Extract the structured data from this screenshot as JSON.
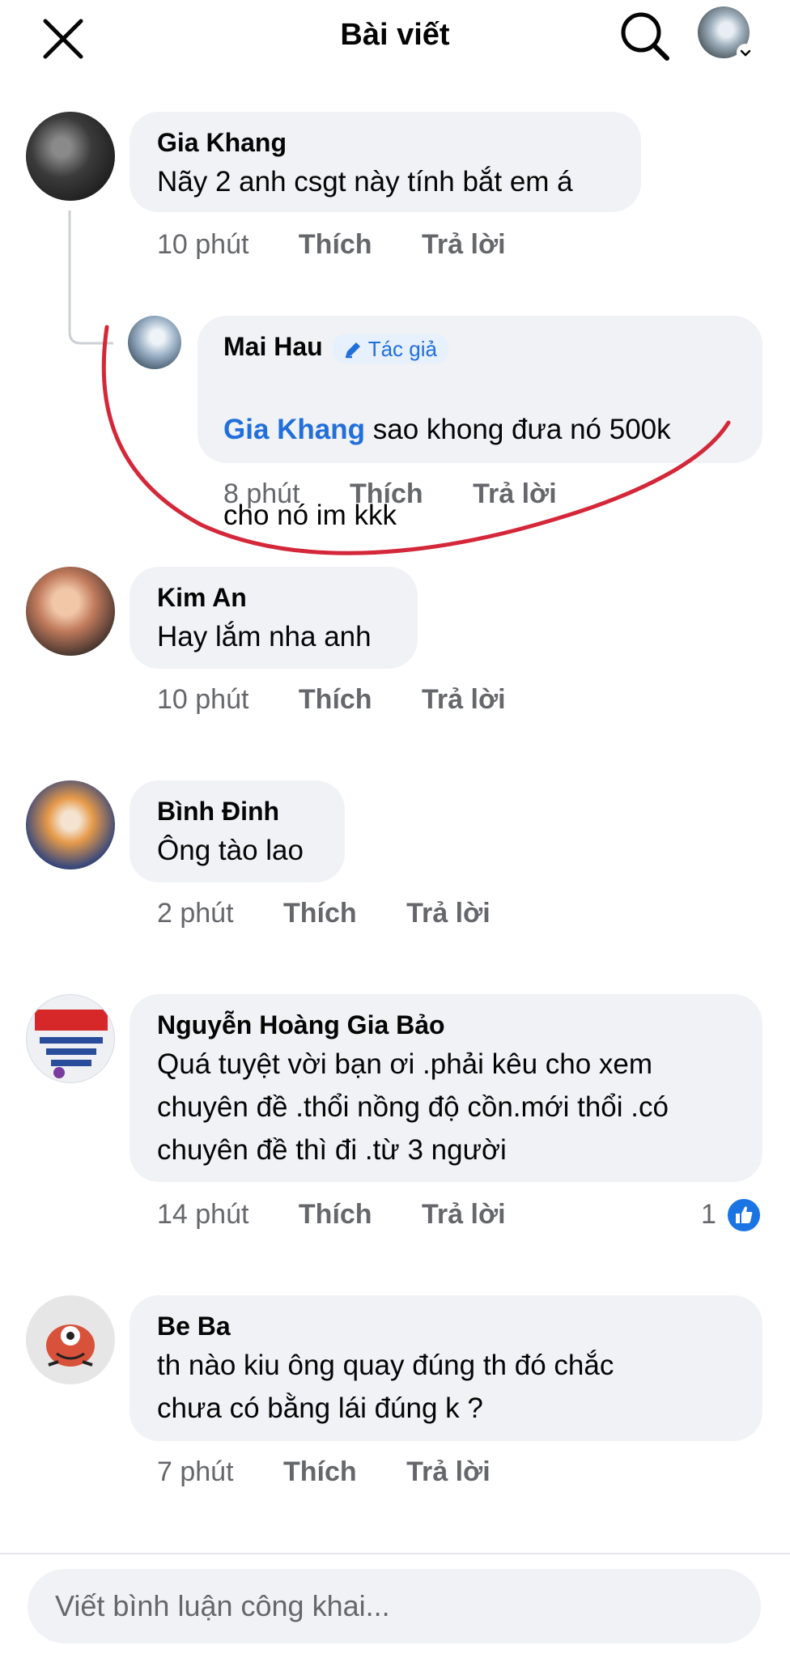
{
  "header": {
    "title": "Bài viết",
    "close_icon": "close-icon",
    "search_icon": "search-icon"
  },
  "comments": [
    {
      "author": "Gia Khang",
      "text": "Nãy 2 anh csgt này tính bắt em á",
      "time": "10 phút",
      "like": "Thích",
      "reply": "Trả lời"
    },
    {
      "author": "Mai Hau",
      "badge": "Tác giả",
      "mention": "Gia Khang",
      "text_line1": "sao khong đưa nó 500k",
      "text_line2": "cho nó im kkk",
      "time": "8 phút",
      "like": "Thích",
      "reply": "Trả lời"
    },
    {
      "author": "Kim An",
      "text": "Hay lắm nha anh",
      "time": "10 phút",
      "like": "Thích",
      "reply": "Trả lời"
    },
    {
      "author": "Bình Đinh",
      "text": "Ông tào lao",
      "time": "2 phút",
      "like": "Thích",
      "reply": "Trả lời"
    },
    {
      "author": "Nguyễn Hoàng Gia Bảo",
      "text": "Quá tuyệt vời bạn ơi .phải kêu cho xem\nchuyên đề .thổi nồng độ cồn.mới thổi .có\nchuyên đề thì đi .từ 3 người",
      "time": "14 phút",
      "like": "Thích",
      "reply": "Trả lời",
      "reaction_count": "1"
    },
    {
      "author": "Be Ba",
      "text": "th nào kiu ông quay đúng th đó chắc\nchưa có bằng lái đúng k ?",
      "time": "7 phút",
      "like": "Thích",
      "reply": "Trả lời"
    }
  ],
  "footer": {
    "placeholder": "Viết bình luận công khai..."
  },
  "colors": {
    "bubble": "#f0f2f5",
    "mention": "#216fdb",
    "annotation": "#d4283a",
    "like_blue": "#1b74e4"
  }
}
